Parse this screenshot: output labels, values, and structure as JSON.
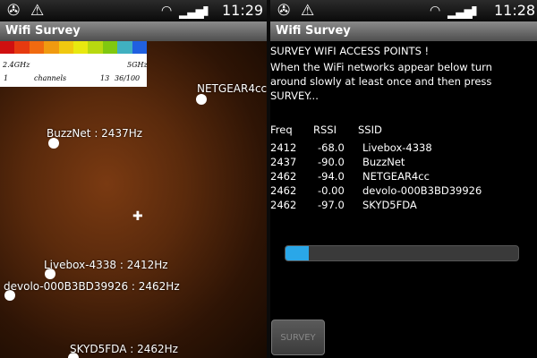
{
  "left_screen": {
    "status": {
      "time": "11:29"
    },
    "app_title": "Wifi Survey",
    "legend": {
      "left_label": "2.4GHz",
      "right_label": "5GHz",
      "channel_start": "1",
      "channels_word": "channels",
      "channel_end": "13",
      "ratio": "36/100",
      "colors": [
        "#d01010",
        "#e63a10",
        "#f06a10",
        "#f09a10",
        "#f0c810",
        "#e8e810",
        "#b8d810",
        "#80c810",
        "#40b0c0",
        "#2060e0"
      ]
    },
    "access_points": [
      {
        "label": "NETGEAR4cc"
      },
      {
        "label": "BuzzNet : 2437Hz"
      },
      {
        "label": "Livebox-4338 : 2412Hz"
      },
      {
        "label": "devolo-000B3BD39926 : 2462Hz"
      },
      {
        "label": "SKYD5FDA : 2462Hz"
      }
    ]
  },
  "right_screen": {
    "status": {
      "time": "11:28"
    },
    "app_title": "Wifi Survey",
    "heading": "SURVEY WIFI ACCESS POINTS !",
    "instructions": [
      "When the WiFi networks appear below turn",
      "around slowly at least once and then press",
      "SURVEY..."
    ],
    "table": {
      "headers": [
        "Freq",
        "RSSI",
        "SSID"
      ],
      "rows": [
        [
          "2412",
          "-68.0",
          "Livebox-4338"
        ],
        [
          "2437",
          "-90.0",
          "BuzzNet"
        ],
        [
          "2462",
          "-94.0",
          "NETGEAR4cc"
        ],
        [
          "2462",
          "-0.00",
          "devolo-000B3BD39926"
        ],
        [
          "2462",
          "-97.0",
          "SKYD5FDA"
        ]
      ]
    },
    "progress_fraction": 0.1,
    "survey_button": "SURVEY"
  },
  "icons": [
    "usb-debug-icon",
    "warning-icon",
    "wifi-icon",
    "signal-icon",
    "battery-icon"
  ]
}
